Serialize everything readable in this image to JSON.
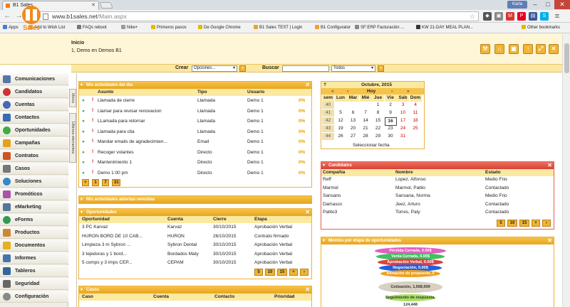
{
  "browser": {
    "tab_title": "B1 Sales",
    "url_prefix": "www.b1sales.net",
    "url_path": "/Main.aspx",
    "user_badge": "Karla",
    "bookmarks": [
      "Apps",
      "Add to Wish List",
      "FAQs reboot",
      "Nike+",
      "Primeros pasos",
      "De Google Chrome",
      "B1 Sales TEST | Login",
      "B1 Configurator",
      "SF:ERP Facturación ...",
      "KW 21-DAY MEAL PLAN...",
      "Other bookmarks"
    ]
  },
  "colors": {
    "accent": "#f1b433",
    "header_bg": "#fef6d6",
    "red_panel": "#d84030"
  },
  "header": {
    "logo_text": "Sales",
    "title": "Inicio",
    "welcome": "1, Demo en Demos B1"
  },
  "topbar": {
    "create_label": "Crear",
    "create_value": "Opciones...",
    "search_label": "Buscar",
    "search_scope": "Todos",
    "go": ">"
  },
  "sidebar": {
    "items": [
      "Comunicaciones",
      "Candidatos",
      "Cuentas",
      "Contactos",
      "Oportunidades",
      "Campañas",
      "Contratos",
      "Casos",
      "Soluciones",
      "Promóticos",
      "eMarketing",
      "eForms",
      "Productos",
      "Documentos",
      "Informes",
      "Tableros",
      "Seguridad",
      "Configuración"
    ]
  },
  "vtabs": [
    "Menú",
    "Últimos elementos"
  ],
  "activities": {
    "title": "Mis actividades del día",
    "headers": [
      "Asunto",
      "Tipo",
      "Usuario"
    ],
    "rows": [
      {
        "subject": "Llamada de cierre",
        "type": "Llamada",
        "user": "Demo 1",
        "pct": "0%"
      },
      {
        "subject": "Llamar para revisar renovacion",
        "type": "Llamada",
        "user": "Demo 1",
        "pct": "0%"
      },
      {
        "subject": "LLamada para retornar",
        "type": "Llamada",
        "user": "Demo 1",
        "pct": "0%"
      },
      {
        "subject": "Llamada para cita",
        "type": "Llamada",
        "user": "Demo 1",
        "pct": "0%"
      },
      {
        "subject": "Mandar emails de agradecimien...",
        "type": "Email",
        "user": "Demo 1",
        "pct": "0%"
      },
      {
        "subject": "Recoger volantes",
        "type": "Directo",
        "user": "Demo 1",
        "pct": "0%"
      },
      {
        "subject": "Mantenimiento 1",
        "type": "Directo",
        "user": "Demo 1",
        "pct": "0%"
      },
      {
        "subject": "Demo 1:00 pm",
        "type": "Directo",
        "user": "Demo 1",
        "pct": "0%"
      }
    ],
    "buttons": [
      "+",
      "1",
      "7",
      "31"
    ]
  },
  "overdue": {
    "title": "Mis actividades abiertas vencidas"
  },
  "opportunities": {
    "title": "Oportunidades",
    "headers": [
      "Oportunidad",
      "Cuenta",
      "Cierre",
      "Etapa"
    ],
    "rows": [
      {
        "name": "3 PC Karvaz",
        "account": "Karvaz",
        "close": "30/10/2015",
        "stage": "Aprobación Verbal"
      },
      {
        "name": "HURON BORD DE 10 CAB...",
        "account": "HURON",
        "close": "26/10/2015",
        "stage": "Contrato firmado"
      },
      {
        "name": "Limpieza 3 m Sybron ...",
        "account": "Sybron Dental",
        "close": "30/10/2015",
        "stage": "Aprobación Verbal"
      },
      {
        "name": "3 tejedoras y 1 bord...",
        "account": "Bordados Maty",
        "close": "30/10/2015",
        "stage": "Aprobación Verbal"
      },
      {
        "name": "5 comps y 3 imps CEP...",
        "account": "CEPAM",
        "close": "30/10/2015",
        "stage": "Aprobación Verbal"
      }
    ],
    "pager": [
      "5",
      "10",
      "15",
      "+",
      "›"
    ]
  },
  "cases": {
    "title": "Casos",
    "headers": [
      "Caso",
      "Cuenta",
      "Contacto",
      "Prioridad"
    ]
  },
  "calendar": {
    "button": "?",
    "month_year": "Octubre, 2015",
    "nav": [
      "«",
      "‹",
      "Hoy",
      "›",
      "»"
    ],
    "weekdays": [
      "sem",
      "Lun",
      "Mar",
      "Mié",
      "Jue",
      "Vie",
      "Sáb",
      "Dom"
    ],
    "weeks": [
      [
        "40",
        "",
        "",
        "",
        "1",
        "2",
        "3",
        "4"
      ],
      [
        "41",
        "5",
        "6",
        "7",
        "8",
        "9",
        "10",
        "11"
      ],
      [
        "42",
        "12",
        "13",
        "14",
        "15",
        "16",
        "17",
        "18"
      ],
      [
        "43",
        "19",
        "20",
        "21",
        "22",
        "23",
        "24",
        "25"
      ],
      [
        "44",
        "26",
        "27",
        "28",
        "29",
        "30",
        "31",
        ""
      ]
    ],
    "today": "16",
    "footer": "Seleccionar fecha"
  },
  "candidates": {
    "title": "Candidatos",
    "headers": [
      "Compañía",
      "Nombre",
      "Estado"
    ],
    "rows": [
      {
        "company": "Reff",
        "name": "Lopez, Alfonso",
        "status": "Medio Frio"
      },
      {
        "company": "Marmol",
        "name": "Marmol, Pablo",
        "status": "Contactado"
      },
      {
        "company": "Sansans",
        "name": "Sansana, Norma",
        "status": "Medio Frio"
      },
      {
        "company": "Damasco",
        "name": "Jeez, Arturo",
        "status": "Contactado"
      },
      {
        "company": "Patito3",
        "name": "Torres, Paty",
        "status": "Contactado"
      }
    ],
    "pager": [
      "5",
      "10",
      "15",
      "+",
      "›"
    ]
  },
  "funnel": {
    "title": "Montos por etapa de oportunidades",
    "labels": [
      "Pérdida Cerrada, 0.00$",
      "Venta Cerrada, 0.00$",
      "Aprobación Verbal, 0.00$",
      "Negociación, 0.00$",
      "Afinación de propuesta, 0",
      "Cotización, 1,568,009",
      "Seguimiento de respuesta, 124,448"
    ],
    "colors": [
      "#e060c0",
      "#e050a0",
      "#40c060",
      "#e04040",
      "#2060e0",
      "#f0a020",
      "#50b0e0",
      "#90d040"
    ]
  }
}
